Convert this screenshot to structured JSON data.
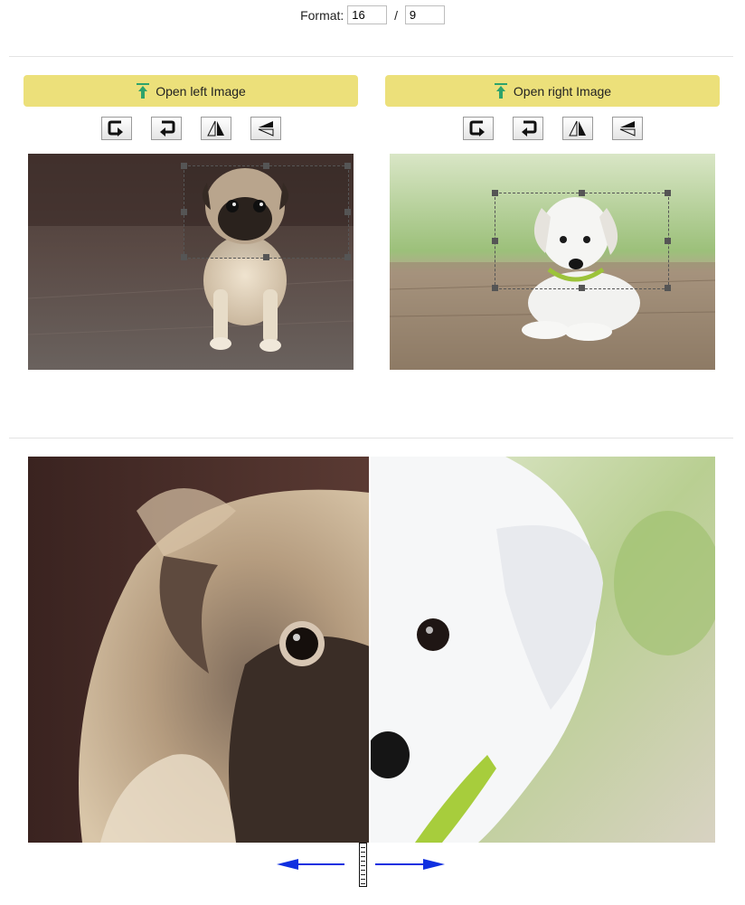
{
  "format": {
    "label": "Format:",
    "width": "16",
    "separator": "/",
    "height": "9"
  },
  "left_panel": {
    "open_label": "Open left Image",
    "tools": [
      "rotate-right-icon",
      "rotate-left-icon",
      "flip-horizontal-icon",
      "flip-vertical-icon"
    ]
  },
  "right_panel": {
    "open_label": "Open right Image",
    "tools": [
      "rotate-right-icon",
      "rotate-left-icon",
      "flip-horizontal-icon",
      "flip-vertical-icon"
    ]
  },
  "colors": {
    "button_bg": "#ece07a",
    "upload_icon": "#2ea36b",
    "arrow": "#1030e0"
  },
  "slider": {
    "split": 0.5
  }
}
